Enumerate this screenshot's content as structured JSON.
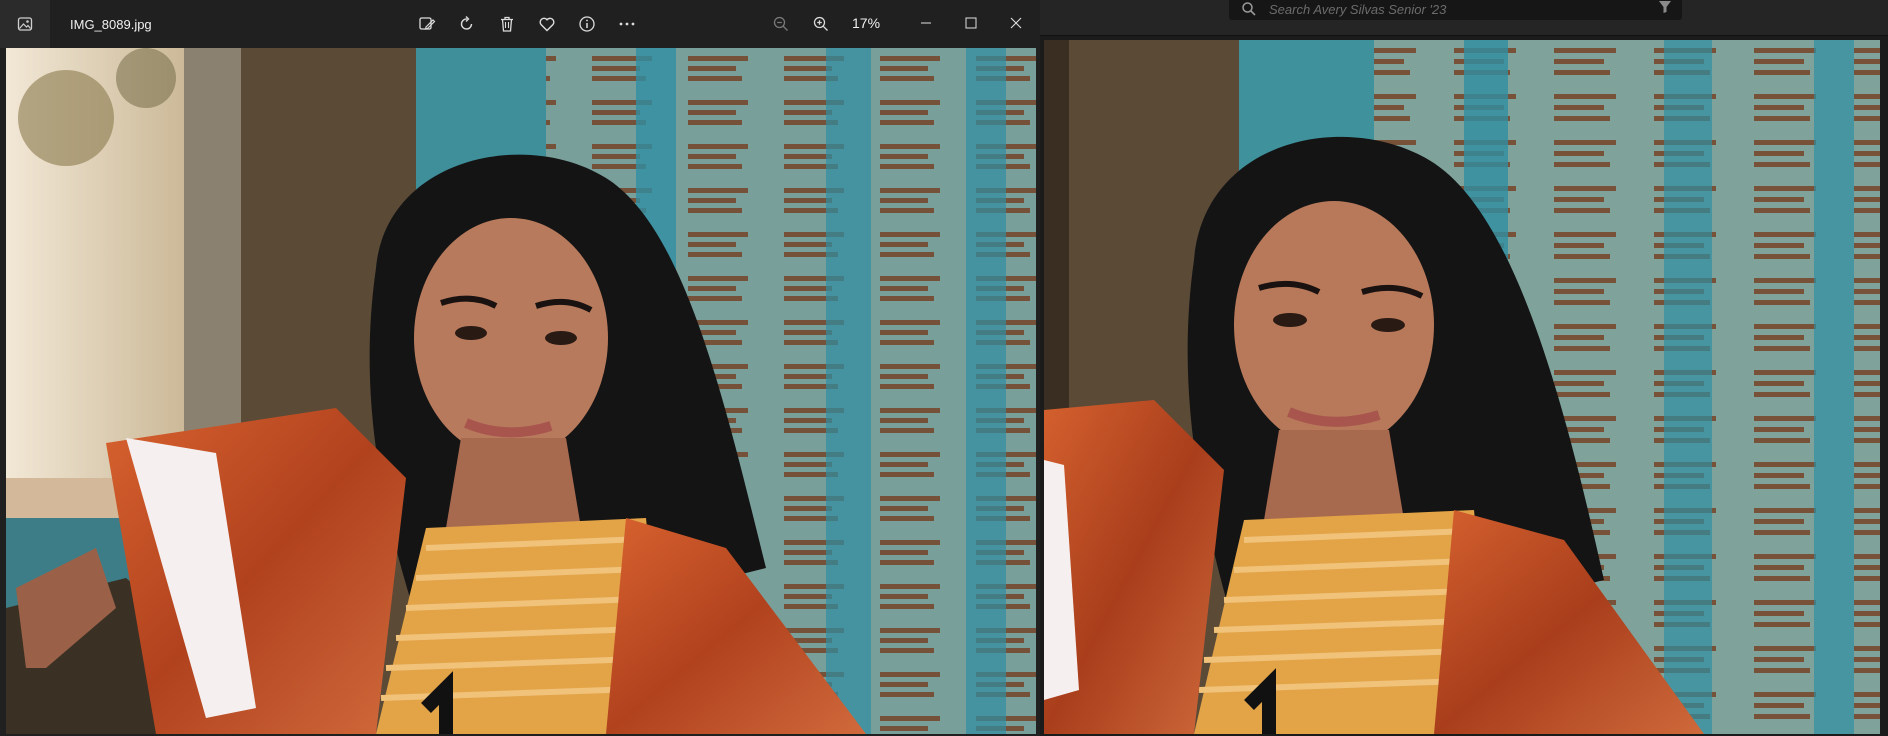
{
  "viewer": {
    "title": "IMG_8089.jpg",
    "zoom_level": "17%",
    "toolbar": {
      "icons": [
        "edit-image-icon",
        "rotate-icon",
        "delete-icon",
        "favorite-icon",
        "info-icon",
        "more-icon",
        "zoom-out-icon",
        "zoom-in-icon"
      ]
    },
    "window_controls": [
      "minimize-icon",
      "maximize-icon",
      "close-icon"
    ]
  },
  "editor": {
    "search_placeholder": "Search Avery Silvas Senior '23"
  },
  "colors": {
    "window_bg": "#202020",
    "editor_bg": "#1b1b1b",
    "teal_wall": "#3f8f9a",
    "plaque_brown": "#7a4a30",
    "jacket_orange": "#c1532a",
    "shirt_yellow": "#e3a347"
  }
}
